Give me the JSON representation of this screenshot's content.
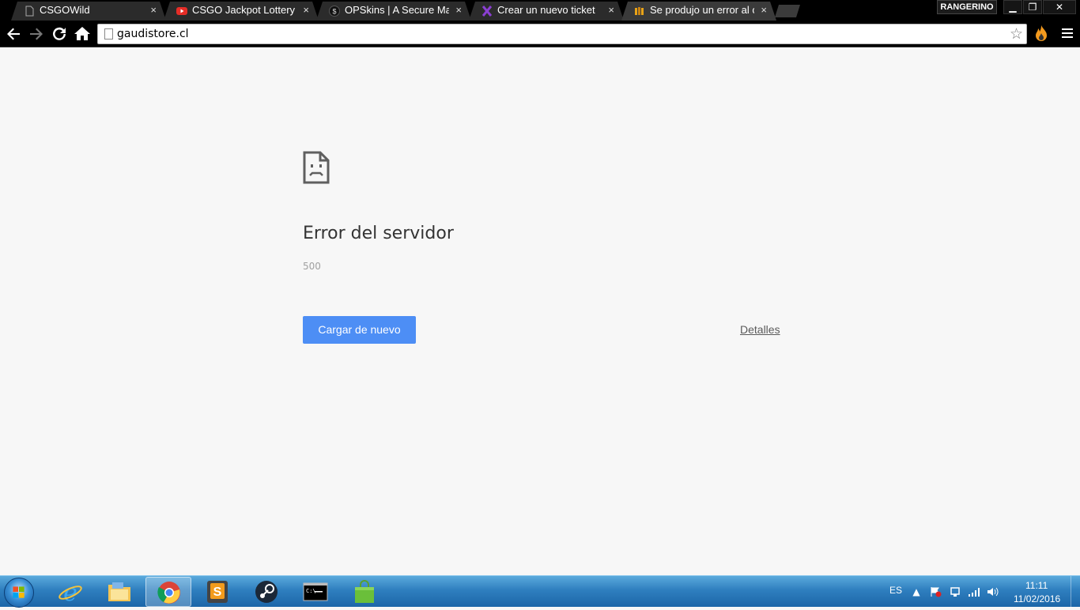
{
  "browser": {
    "tabs": [
      {
        "title": "CSGOWild",
        "icon": "blank-page-icon",
        "close": "×"
      },
      {
        "title": "CSGO Jackpot Lottery WEB",
        "icon": "youtube-icon",
        "close": "×"
      },
      {
        "title": "OPSkins | A Secure Market",
        "icon": "opskins-icon",
        "close": "×"
      },
      {
        "title": "Crear un nuevo ticket",
        "icon": "ticket-icon",
        "close": "×"
      },
      {
        "title": "Se produjo un error al cargar",
        "icon": "server-icon",
        "close": "×"
      }
    ],
    "active_tab_index": 4,
    "profile_name": "RANGERINO",
    "window_controls": {
      "minimize": "▁",
      "restore": "❐",
      "close": "✕"
    },
    "address": "gaudistore.cl",
    "colors": {
      "chrome_bg": "#000000",
      "tab_bg": "#2b2b2b"
    }
  },
  "error_page": {
    "title": "Error del servidor",
    "code": "500",
    "reload_label": "Cargar de nuevo",
    "details_label": "Detalles",
    "colors": {
      "button": "#4d8ef5",
      "background": "#f7f7f7"
    }
  },
  "taskbar": {
    "apps": [
      {
        "name": "internet-explorer"
      },
      {
        "name": "file-explorer"
      },
      {
        "name": "chrome",
        "active": true
      },
      {
        "name": "sublime-text"
      },
      {
        "name": "steam"
      },
      {
        "name": "command-prompt"
      },
      {
        "name": "shopping-bag"
      }
    ],
    "language": "ES",
    "time": "11:11",
    "date": "11/02/2016"
  }
}
